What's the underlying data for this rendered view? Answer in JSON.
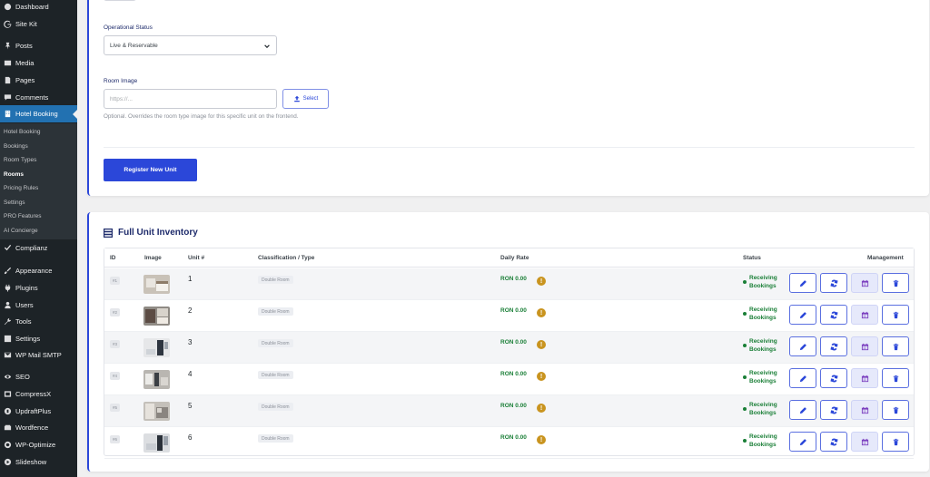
{
  "sidebar": {
    "items": [
      {
        "label": "Dashboard",
        "icon": "dashboard-icon"
      },
      {
        "label": "Site Kit",
        "icon": "sitekit-icon"
      },
      {
        "label": "Posts",
        "icon": "pin-icon"
      },
      {
        "label": "Media",
        "icon": "media-icon"
      },
      {
        "label": "Pages",
        "icon": "pages-icon"
      },
      {
        "label": "Comments",
        "icon": "comments-icon"
      },
      {
        "label": "Hotel Booking",
        "icon": "building-icon"
      },
      {
        "label": "Complianz",
        "icon": "check-icon"
      },
      {
        "label": "Appearance",
        "icon": "brush-icon"
      },
      {
        "label": "Plugins",
        "icon": "plug-icon"
      },
      {
        "label": "Users",
        "icon": "users-icon"
      },
      {
        "label": "Tools",
        "icon": "wrench-icon"
      },
      {
        "label": "Settings",
        "icon": "settings-icon"
      },
      {
        "label": "WP Mail SMTP",
        "icon": "mail-icon"
      },
      {
        "label": "SEO",
        "icon": "seo-icon"
      },
      {
        "label": "CompressX",
        "icon": "compress-icon"
      },
      {
        "label": "UpdraftPlus",
        "icon": "updraft-icon"
      },
      {
        "label": "Wordfence",
        "icon": "wordfence-icon"
      },
      {
        "label": "WP-Optimize",
        "icon": "optimize-icon"
      },
      {
        "label": "Slideshow",
        "icon": "slideshow-icon"
      }
    ],
    "submenu": [
      "Hotel Booking",
      "Bookings",
      "Room Types",
      "Rooms",
      "Pricing Rules",
      "Settings",
      "PRO Features",
      "AI Concierge"
    ],
    "active_item": "Hotel Booking",
    "current_subitem": "Rooms"
  },
  "form": {
    "status_label": "Operational Status",
    "status_value": "Live & Reservable",
    "image_label": "Room Image",
    "image_placeholder": "https://...",
    "select_button": "Select",
    "image_help": "Optional. Overrides the room type image for this specific unit on the frontend.",
    "register_button": "Register New Unit"
  },
  "inventory": {
    "title": "Full Unit Inventory",
    "columns": [
      "ID",
      "Image",
      "Unit #",
      "Classification / Type",
      "Daily Rate",
      "Status",
      "Management"
    ],
    "rows": [
      {
        "id": "#1",
        "unit": "1",
        "type": "Double Room",
        "rate": "RON 0.00",
        "status": "Receiving Bookings"
      },
      {
        "id": "#2",
        "unit": "2",
        "type": "Double Room",
        "rate": "RON 0.00",
        "status": "Receiving Bookings"
      },
      {
        "id": "#3",
        "unit": "3",
        "type": "Double Room",
        "rate": "RON 0.00",
        "status": "Receiving Bookings"
      },
      {
        "id": "#4",
        "unit": "4",
        "type": "Double Room",
        "rate": "RON 0.00",
        "status": "Receiving Bookings"
      },
      {
        "id": "#5",
        "unit": "5",
        "type": "Double Room",
        "rate": "RON 0.00",
        "status": "Receiving Bookings"
      },
      {
        "id": "#6",
        "unit": "6",
        "type": "Double Room",
        "rate": "RON 0.00",
        "status": "Receiving Bookings"
      }
    ]
  },
  "colors": {
    "sidebar_bg": "#1d2327",
    "active_menu": "#2271b1",
    "accent": "#2b47d9",
    "status_green": "#1a7f37",
    "warning": "#c9941f"
  }
}
